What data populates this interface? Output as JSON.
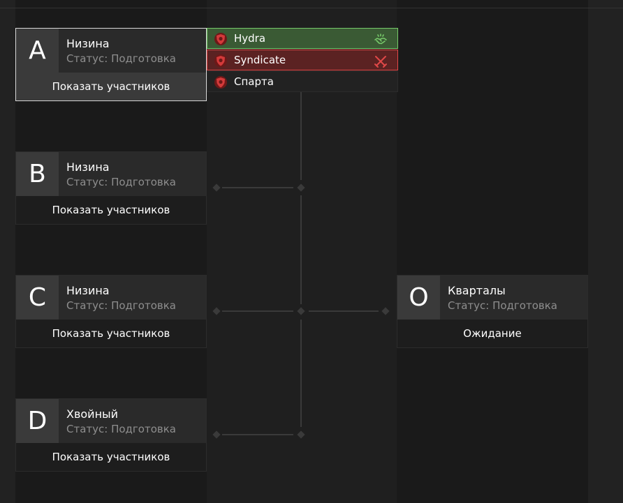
{
  "groups": [
    {
      "letter": "A",
      "name": "Низина",
      "status": "Статус: Подготовка",
      "button": "Показать участников"
    },
    {
      "letter": "B",
      "name": "Низина",
      "status": "Статус: Подготовка",
      "button": "Показать участников"
    },
    {
      "letter": "C",
      "name": "Низина",
      "status": "Статус: Подготовка",
      "button": "Показать участников"
    },
    {
      "letter": "D",
      "name": "Хвойный",
      "status": "Статус: Подготовка",
      "button": "Показать участников"
    }
  ],
  "final": {
    "letter": "O",
    "name": "Кварталы",
    "status": "Статус: Подготовка",
    "button": "Ожидание"
  },
  "participants": [
    {
      "name": "Hydra",
      "state": "ally",
      "icon": "handshake-icon"
    },
    {
      "name": "Syndicate",
      "state": "enemy",
      "icon": "crossed-swords-icon"
    },
    {
      "name": "Спарта",
      "state": "neutral",
      "icon": ""
    }
  ],
  "colors": {
    "ally": "#77c96a",
    "enemy": "#e04848",
    "shield": "#d33a3a"
  }
}
